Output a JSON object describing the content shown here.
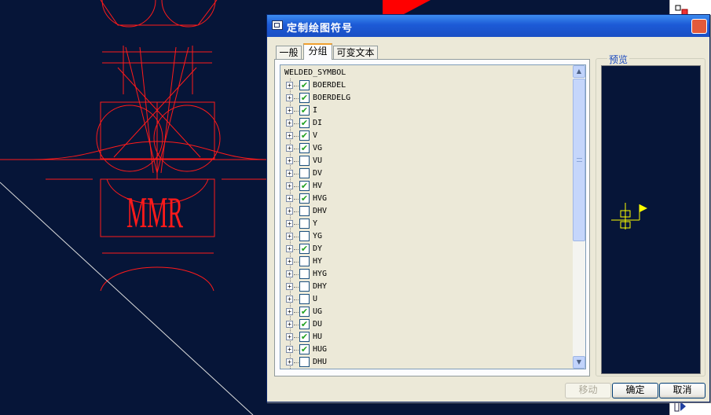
{
  "dialog": {
    "title": "定制绘图符号",
    "close_glyph": "✕",
    "tabs": [
      {
        "label": "一般",
        "active": false
      },
      {
        "label": "分组",
        "active": true
      },
      {
        "label": "可变文本",
        "active": false
      }
    ],
    "tree": {
      "root": "WELDED_SYMBOL",
      "items": [
        {
          "label": "BOERDEL",
          "checked": true
        },
        {
          "label": "BOERDELG",
          "checked": true
        },
        {
          "label": "I",
          "checked": true
        },
        {
          "label": "DI",
          "checked": true
        },
        {
          "label": "V",
          "checked": true
        },
        {
          "label": "VG",
          "checked": true
        },
        {
          "label": "VU",
          "checked": false
        },
        {
          "label": "DV",
          "checked": false
        },
        {
          "label": "HV",
          "checked": true
        },
        {
          "label": "HVG",
          "checked": true
        },
        {
          "label": "DHV",
          "checked": false
        },
        {
          "label": "Y",
          "checked": false
        },
        {
          "label": "YG",
          "checked": false
        },
        {
          "label": "DY",
          "checked": true
        },
        {
          "label": "HY",
          "checked": false
        },
        {
          "label": "HYG",
          "checked": false
        },
        {
          "label": "DHY",
          "checked": false
        },
        {
          "label": "U",
          "checked": false
        },
        {
          "label": "UG",
          "checked": true
        },
        {
          "label": "DU",
          "checked": true
        },
        {
          "label": "HU",
          "checked": true
        },
        {
          "label": "HUG",
          "checked": true
        },
        {
          "label": "DHU",
          "checked": false
        }
      ]
    },
    "preview_label": "预览",
    "buttons": {
      "move": "移动",
      "ok": "确定",
      "cancel": "取消"
    }
  },
  "cad_text": "MMR",
  "check_glyph": "✔",
  "expander_glyph": "+",
  "colors": {
    "canvas_bg": "#061538",
    "cad_red": "#ff1a1a",
    "preview_yellow": "#ffff00",
    "title_blue": "#1c5ad6",
    "check_green": "#21a121"
  }
}
